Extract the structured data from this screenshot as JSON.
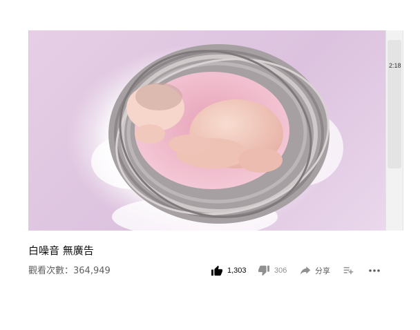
{
  "video": {
    "title": "白噪音 無廣告",
    "views": "觀看次數：364,949",
    "up_next_time": "2:18"
  },
  "actions": {
    "like_count": "1,303",
    "dislike_count": "306",
    "share_label": "分享"
  },
  "icons": {
    "like": "thumbs-up-icon",
    "dislike": "thumbs-down-icon",
    "share": "share-arrow-icon",
    "save": "add-to-playlist-icon",
    "more": "more-horizontal-icon"
  },
  "colors": {
    "accent": "#030303",
    "secondary": "#606060",
    "muted": "#909090"
  }
}
